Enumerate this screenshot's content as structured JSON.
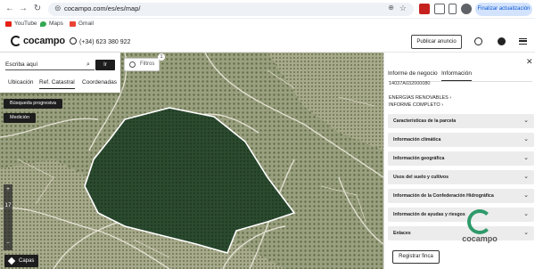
{
  "browser": {
    "url": "cocampo.com/es/es/map/",
    "update_label": "Finalizar actualización",
    "bookmarks": [
      "YouTube",
      "Maps",
      "Gmail"
    ],
    "colors": {
      "youtube": "#e62117",
      "maps": "#34a853",
      "gmail": "#ea4335"
    }
  },
  "header": {
    "logo_text": "cocampo",
    "phone": "(+34) 623 380 922",
    "publish_label": "Publicar anuncio",
    "icons": [
      "whatsapp-icon",
      "globe-icon",
      "user-icon",
      "menu-icon"
    ]
  },
  "search": {
    "placeholder": "Escriba aquí",
    "go_label": "Ir",
    "tabs": [
      "Ubicación",
      "Ref. Catastral",
      "Coordenadas"
    ],
    "active_tab": "Ref. Catastral"
  },
  "map_controls": {
    "filter_label": "Filtros",
    "filter_count": "1",
    "progressive_search_label": "Búsqueda progresiva",
    "measure_label": "Medición",
    "zoom_in": "+",
    "zoom_level": "17",
    "zoom_out": "−",
    "layers_label": "Capas"
  },
  "side_panel": {
    "tabs": [
      "Informe de negocio",
      "Información"
    ],
    "active_tab": "Información",
    "ref_number": "14037A032000080",
    "links": [
      "ENERGÍAS RENOVABLES",
      "INFORME COMPLETO"
    ],
    "sections": [
      "Características de la parcela",
      "Información climática",
      "Información geográfica",
      "Usos del suelo y cultivos",
      "Información de la Confederación Hidrográfica",
      "Información de ayudas y riesgos",
      "Enlaces"
    ],
    "register_label": "Registrar finca",
    "watermark_text": "cocampo"
  }
}
